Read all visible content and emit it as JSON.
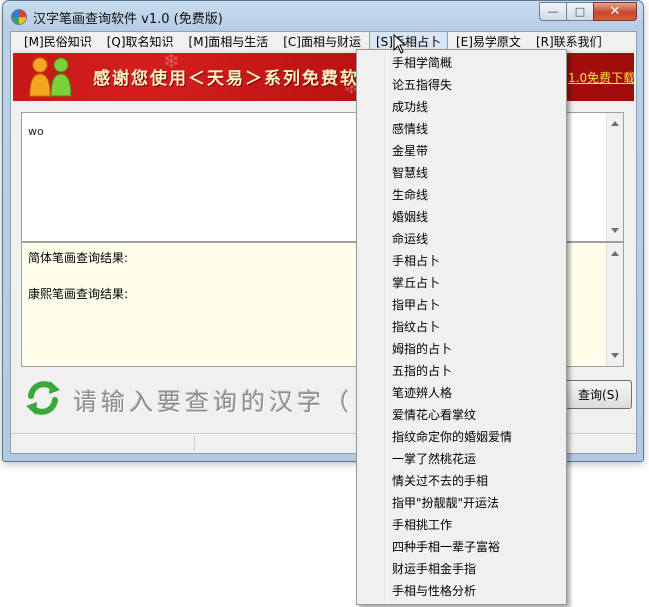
{
  "window": {
    "title": "汉字笔画查询软件 v1.0 (免费版)",
    "minimize_glyph": "—",
    "maximize_glyph": "□",
    "close_glyph": "✕"
  },
  "menu": [
    {
      "label": "[M]民俗知识"
    },
    {
      "label": "[Q]取名知识"
    },
    {
      "label": "[M]面相与生活"
    },
    {
      "label": "[C]面相与财运"
    },
    {
      "label": "[S]手相占卜"
    },
    {
      "label": "[E]易学原文"
    },
    {
      "label": "[R]联系我们"
    }
  ],
  "banner": {
    "text": "感谢您使用＜天易＞系列免费软",
    "link": "1.0免费下载"
  },
  "input": {
    "value": "wo"
  },
  "results": {
    "simplified_label": "简体笔画查询结果:",
    "kangxi_label": "康熙笔画查询结果:"
  },
  "bottom": {
    "prompt": "请输入要查询的汉字（",
    "query_button": "查询(S)"
  },
  "dropdown_items": [
    "手相学简概",
    "论五指得失",
    "成功线",
    "感情线",
    "金星带",
    "智慧线",
    "生命线",
    "婚姻线",
    "命运线",
    "手相占卜",
    "掌丘占卜",
    "指甲占卜",
    "指纹占卜",
    "姆指的占卜",
    "五指的占卜",
    "笔迹辨人格",
    "爱情花心看掌纹",
    "指纹命定你的婚姻爱情",
    "一掌了然桃花运",
    "情关过不去的手相",
    "指甲\"扮靓靓\"开运法",
    "手相挑工作",
    "四种手相一辈子富裕",
    "财运手相金手指",
    "手相与性格分析"
  ]
}
